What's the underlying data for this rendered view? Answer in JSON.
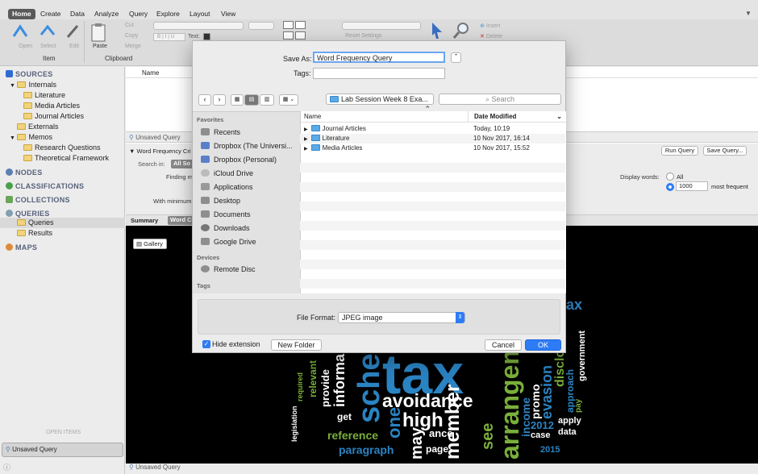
{
  "ribbon": {
    "tabs": [
      "Home",
      "Create",
      "Data",
      "Analyze",
      "Query",
      "Explore",
      "Layout",
      "View"
    ],
    "active_tab": "Home",
    "groups": {
      "item": "Item",
      "clipboard": "Clipboard"
    },
    "buttons": {
      "paste": "Paste",
      "cut": "Cut",
      "copy": "Copy",
      "merge": "Merge",
      "insert": "Insert",
      "delete": "Delete",
      "reset_settings": "Reset Settings",
      "text": "Text:",
      "bold": "B",
      "italic": "I",
      "underline": "U",
      "open": "Open",
      "select": "Select",
      "edit": "Edit"
    }
  },
  "sidebar": {
    "sources": "SOURCES",
    "internals": "Internals",
    "internal_items": [
      "Literature",
      "Media Articles",
      "Journal Articles"
    ],
    "externals": "Externals",
    "memos": "Memos",
    "memo_items": [
      "Research Questions",
      "Theoretical Framework"
    ],
    "nodes": "NODES",
    "classifications": "CLASSIFICATIONS",
    "collections": "COLLECTIONS",
    "queries": "QUERIES",
    "query_items": [
      "Queries",
      "Results"
    ],
    "maps": "MAPS",
    "open_items": "OPEN ITEMS",
    "open_item": "Unsaved Query"
  },
  "main": {
    "column_name": "Name",
    "query_tab": "Unsaved Query",
    "query_title": "Word Frequency Cri",
    "search_in_label": "Search in:",
    "search_in_value": "All So",
    "finding_label": "Finding m",
    "with_minimum": "With minimum",
    "run_query": "Run Query",
    "save_query": "Save Query...",
    "display_words": "Display words:",
    "opt_all": "All",
    "opt_count": "1000",
    "most_frequent": "most frequent",
    "view_tabs": [
      "Summary",
      "Word C"
    ],
    "gallery": "Gallery",
    "status": "Unsaved Query"
  },
  "wordcloud": {
    "words": [
      "tax",
      "avoidance",
      "high",
      "scheme",
      "arrangement",
      "reference",
      "paragraph",
      "informa",
      "provide",
      "relevant",
      "required",
      "legislation",
      "get",
      "one",
      "may",
      "member",
      "promo",
      "income",
      "evasion",
      "disclos",
      "approach",
      "government",
      "pay",
      "apply",
      "data",
      "case",
      "2012",
      "2015",
      "see",
      "page",
      "ance",
      "tax"
    ]
  },
  "dialog": {
    "save_as_label": "Save As:",
    "save_as_value": "Word Frequency Query",
    "tags_label": "Tags:",
    "location": "Lab Session Week 8 Exa...",
    "search_placeholder": "Search",
    "favorites_header": "Favorites",
    "favorites": [
      "Recents",
      "Dropbox (The Universi...",
      "Dropbox (Personal)",
      "iCloud Drive",
      "Applications",
      "Desktop",
      "Documents",
      "Downloads",
      "Google Drive"
    ],
    "devices_header": "Devices",
    "devices": [
      "Remote Disc"
    ],
    "tags_header": "Tags",
    "col_name": "Name",
    "col_date": "Date Modified",
    "files": [
      {
        "name": "Journal Articles",
        "date": "Today, 10:19"
      },
      {
        "name": "Literature",
        "date": "10 Nov 2017, 16:14"
      },
      {
        "name": "Media Articles",
        "date": "10 Nov 2017, 15:52"
      }
    ],
    "file_format_label": "File Format:",
    "file_format_value": "JPEG image",
    "hide_extension": "Hide extension",
    "new_folder": "New Folder",
    "cancel": "Cancel",
    "ok": "OK"
  }
}
